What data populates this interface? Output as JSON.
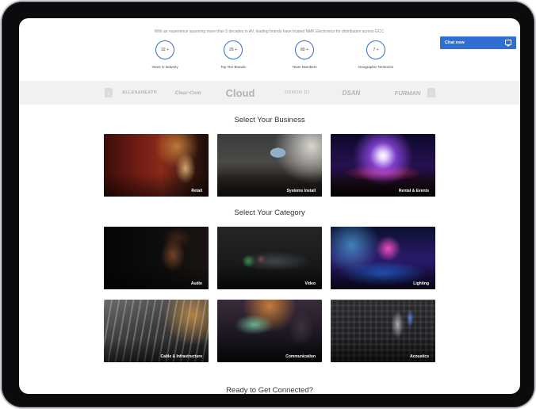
{
  "intro_text": "With an experience spanning more than 5 decades in AV, leading brands have trusted NMK Electronics for distribution across GCC.",
  "stats": [
    {
      "value": "32 +",
      "label": "Years in Industry"
    },
    {
      "value": "25 +",
      "label": "Top Tier Brands"
    },
    {
      "value": "80 +",
      "label": "Team Members"
    },
    {
      "value": "7 +",
      "label": "Geographic Territories"
    }
  ],
  "chat": {
    "label": "Chat now",
    "icon": "chat-bubble-icon"
  },
  "brands": {
    "prev_icon": "‹",
    "next_icon": "›",
    "items": [
      "ALLEN&HEATH",
      "Clear-Com",
      "Cloud",
      "DENON DJ",
      "DSAN",
      "FURMAN"
    ]
  },
  "business": {
    "title": "Select Your Business",
    "cards": [
      {
        "label": "Retail"
      },
      {
        "label": "Systems Install"
      },
      {
        "label": "Rental & Events"
      }
    ]
  },
  "category": {
    "title": "Select Your Category",
    "cards": [
      {
        "label": "Audio"
      },
      {
        "label": "Video"
      },
      {
        "label": "Lighting"
      },
      {
        "label": "Cable & Infrastructure"
      },
      {
        "label": "Communication"
      },
      {
        "label": "Acoustics"
      }
    ]
  },
  "cta_title": "Ready to Get Connected?",
  "colors": {
    "accent": "#2f6fd1",
    "brand_strip": "#f1f1f1"
  }
}
